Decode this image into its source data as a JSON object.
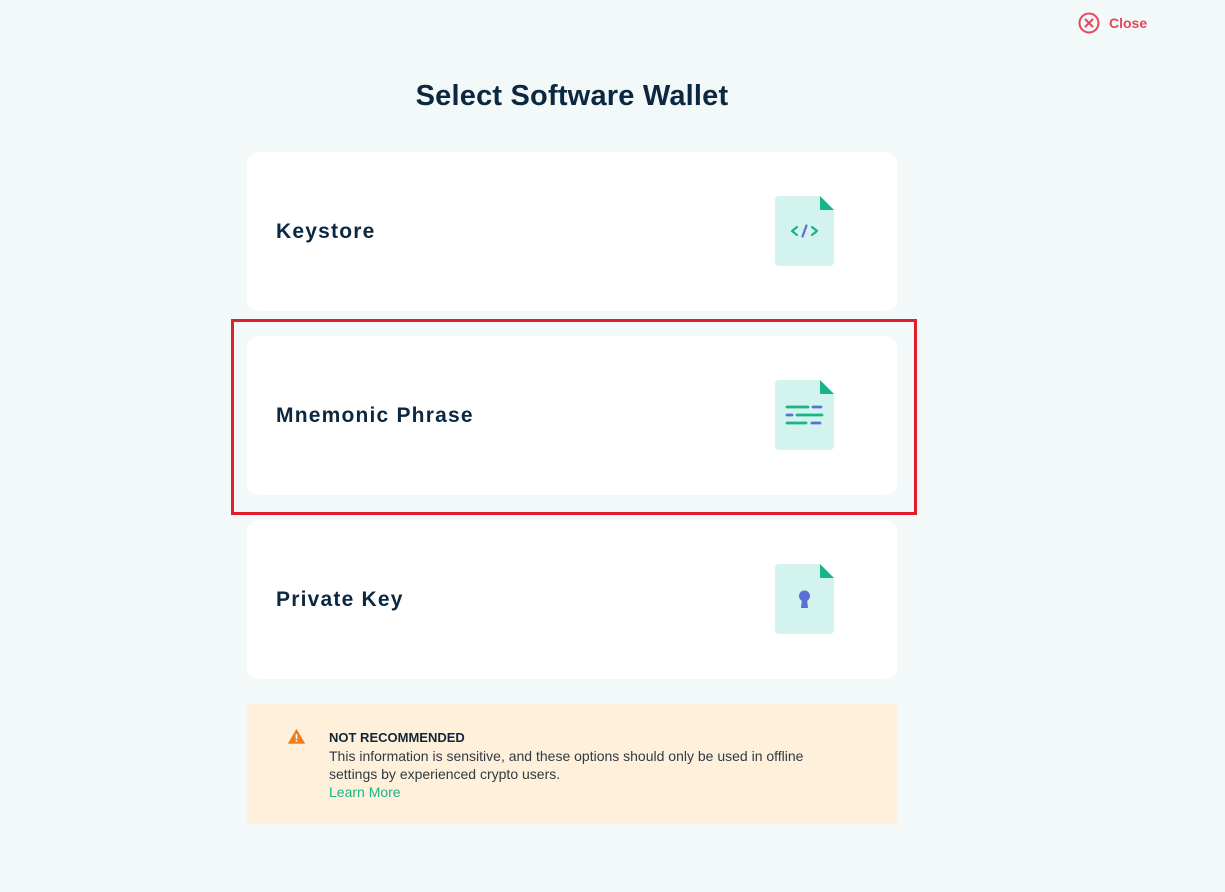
{
  "header": {
    "close_label": "Close"
  },
  "page": {
    "title": "Select Software Wallet"
  },
  "options": [
    {
      "label": "Keystore",
      "icon": "code-file-icon"
    },
    {
      "label": "Mnemonic Phrase",
      "icon": "phrase-file-icon"
    },
    {
      "label": "Private Key",
      "icon": "keyhole-file-icon"
    }
  ],
  "warning": {
    "title": "NOT RECOMMENDED",
    "body": "This information is sensitive, and these options should only be used in offline settings by experienced crypto users.",
    "link": "Learn More",
    "icon": "warning-triangle-icon"
  },
  "colors": {
    "background": "#f2f9f8",
    "accent_green": "#1bb388",
    "close_red": "#e8455a",
    "highlight_red": "#e01f2a",
    "warning_bg": "#fff0dc",
    "warning_orange": "#f07d1a"
  }
}
